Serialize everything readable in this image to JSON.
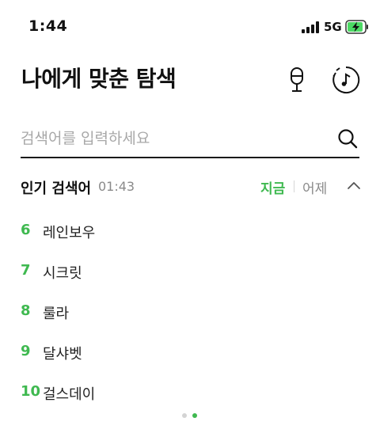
{
  "status_bar": {
    "time": "1:44",
    "network": "5G"
  },
  "header": {
    "title": "나에게 맞춘 탐색"
  },
  "search": {
    "placeholder": "검색어를 입력하세요",
    "value": ""
  },
  "popular": {
    "title": "인기 검색어",
    "time": "01:43",
    "tab_now": "지금",
    "tab_yesterday": "어제",
    "items": [
      {
        "rank": "6",
        "label": "레인보우"
      },
      {
        "rank": "7",
        "label": "시크릿"
      },
      {
        "rank": "8",
        "label": "룰라"
      },
      {
        "rank": "9",
        "label": "달샤벳"
      },
      {
        "rank": "10",
        "label": "걸스데이"
      }
    ]
  },
  "icons": {
    "signal": "signal-bars-icon",
    "battery": "battery-charging-icon",
    "mic": "microphone-icon",
    "music": "music-search-icon",
    "search": "search-icon",
    "collapse": "chevron-up-icon"
  },
  "colors": {
    "accent": "#3fb950",
    "muted": "#8a8a8a"
  },
  "pager": {
    "total": 2,
    "active": 2
  }
}
